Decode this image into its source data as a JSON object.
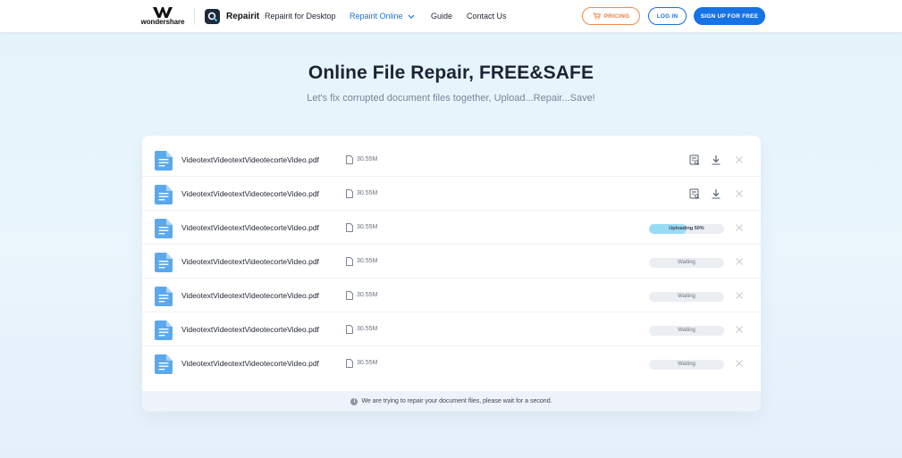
{
  "header": {
    "brand": "wondershare",
    "product": "Repairit",
    "nav": [
      {
        "label": "Repairit for Desktop"
      },
      {
        "label": "Repairit Online"
      },
      {
        "label": "Guide"
      },
      {
        "label": "Contact Us"
      }
    ],
    "pricing_label": "PRICING",
    "login_label": "LOG IN",
    "signup_label": "SIGN UP FOR FREE",
    "colors": {
      "accent": "#1573e6",
      "pricing": "#f07a33"
    }
  },
  "hero": {
    "title": "Online File Repair, FREE&SAFE",
    "subtitle": "Let's fix corrupted document files together, Upload...Repair...Save!"
  },
  "files": [
    {
      "name": "VideotextVideotextVideotecorteVideo.pdf",
      "size": "30.55M",
      "state": "done"
    },
    {
      "name": "VideotextVideotextVideotecorteVideo.pdf",
      "size": "30.55M",
      "state": "done"
    },
    {
      "name": "VideotextVideotextVideotecorteVideo.pdf",
      "size": "30.55M",
      "state": "uploading",
      "status": "Uploading 50%",
      "progress": 0.5
    },
    {
      "name": "VideotextVideotextVideotecorteVideo.pdf",
      "size": "30.55M",
      "state": "waiting",
      "status": "Waiting"
    },
    {
      "name": "VideotextVideotextVideotecorteVideo.pdf",
      "size": "30.55M",
      "state": "waiting",
      "status": "Waiting"
    },
    {
      "name": "VideotextVideotextVideotecorteVideo.pdf",
      "size": "30.55M",
      "state": "waiting",
      "status": "Waiting"
    },
    {
      "name": "VideotextVideotextVideotecorteVideo.pdf",
      "size": "30.55M",
      "state": "waiting",
      "status": "Waiting"
    }
  ],
  "footer": {
    "message": "We are trying to repair your document files, please wait for a second."
  },
  "icons": {
    "file": "pdf-file-icon",
    "size": "document-icon",
    "preview": "preview-icon",
    "download": "download-icon",
    "close": "close-icon",
    "info": "info-icon"
  }
}
